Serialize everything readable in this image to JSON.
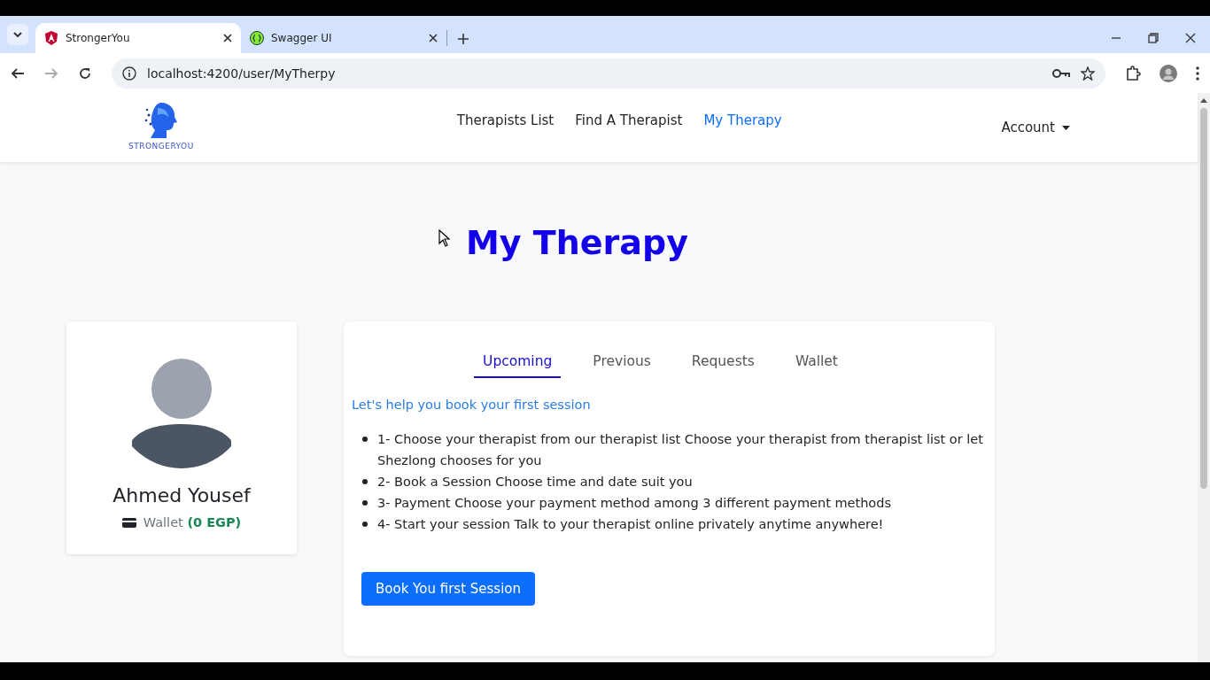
{
  "browser": {
    "tabs": [
      {
        "title": "StrongerYou",
        "selected": true,
        "kind": "angular"
      },
      {
        "title": "Swagger UI",
        "selected": false,
        "kind": "swagger"
      }
    ],
    "address": "localhost:4200/user/MyTherpy"
  },
  "navbar": {
    "brand": "STRONGERYOU",
    "links": [
      {
        "label": "Therapists List",
        "selected": false
      },
      {
        "label": "Find A Therapist",
        "selected": false
      },
      {
        "label": "My Therapy",
        "selected": true
      }
    ],
    "account": "Account"
  },
  "page_title": "My Therapy",
  "profile": {
    "name": "Ahmed Yousef",
    "wallet_label": "Wallet",
    "wallet_amount": "(0 EGP)"
  },
  "tabs": [
    {
      "label": "Upcoming",
      "selected": true
    },
    {
      "label": "Previous",
      "selected": false
    },
    {
      "label": "Requests",
      "selected": false
    },
    {
      "label": "Wallet",
      "selected": false
    }
  ],
  "intro": "Let's help you book your first session",
  "steps": [
    "1- Choose your therapist from our therapist list Choose your therapist from therapist list or let Shezlong chooses for you",
    "2- Book a Session Choose time and date suit you",
    "3- Payment Choose your payment method among 3 different payment methods",
    "4- Start your session Talk to your therapist online privately anytime anywhere!"
  ],
  "book_button": "Book You first Session"
}
